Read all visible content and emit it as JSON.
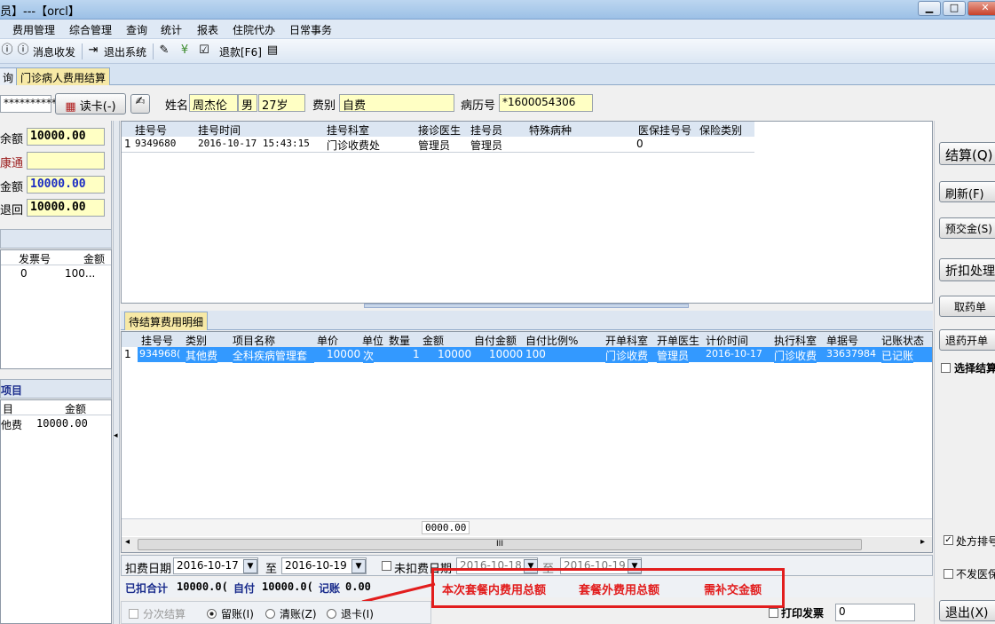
{
  "window": {
    "title": "员】---【orcl】",
    "min": "▁",
    "max": "□",
    "close": "✕"
  },
  "menu": [
    "费用管理",
    "综合管理",
    "查询",
    "统计",
    "报表",
    "住院代办",
    "日常事务"
  ],
  "toolbar": {
    "messages": "消息收发",
    "exit": "退出系统",
    "refund": "退款[F6]"
  },
  "tabs": {
    "prev": "询",
    "current": "门诊病人费用结算"
  },
  "patient": {
    "card_no": "**********",
    "read_card": "读卡(-)",
    "name_label": "姓名",
    "name": "周杰伦",
    "sex": "男",
    "age": "27岁",
    "fee_label": "费别",
    "fee_type": "自费",
    "record_label": "病历号",
    "record_no": "*1600054306"
  },
  "left_panel": {
    "balance_label": "余额",
    "balance": "10000.00",
    "jkt_label": "康通",
    "jkt": "",
    "amount_label": "金额",
    "amount": "10000.00",
    "return_label": "退回",
    "return_value": "10000.00",
    "invoice_headers": [
      "发票号",
      "金额"
    ],
    "invoice_rows": [
      [
        "0",
        "100..."
      ]
    ],
    "items_title": "项目",
    "items_headers": [
      "目",
      "金额"
    ],
    "items_rows": [
      [
        "他费",
        "10000.00"
      ]
    ]
  },
  "reg_table": {
    "headers": [
      "挂号号",
      "挂号时间",
      "挂号科室",
      "接诊医生",
      "挂号员",
      "特殊病种",
      "医保挂号号",
      "保险类别"
    ],
    "rows": [
      [
        "1",
        "9349680",
        "2016-10-17 15:43:15",
        "门诊收费处",
        "管理员",
        "管理员",
        "",
        "0",
        ""
      ]
    ]
  },
  "detail": {
    "tab": "待结算费用明细",
    "headers": [
      "挂号号",
      "类别",
      "项目名称",
      "单价",
      "单位",
      "数量",
      "金额",
      "自付金额",
      "自付比例%",
      "开单科室",
      "开单医生",
      "计价时间",
      "执行科室",
      "单据号",
      "记账状态"
    ],
    "rows": [
      [
        "1",
        "934968(",
        "其他费",
        "全科疾病管理套",
        "10000",
        "次",
        "1",
        "10000",
        "10000",
        "100",
        "门诊收费",
        "管理员",
        "2016-10-17",
        "门诊收费",
        "33637984",
        "已记账"
      ]
    ],
    "footer_total": "0000.00",
    "scroll_grip": "III"
  },
  "filters": {
    "deduct_label": "扣费日期",
    "deduct_from": "2016-10-17",
    "to_label": "至",
    "deduct_to": "2016-10-19",
    "undeduct_label": "未扣费日期",
    "undeduct_from": "2016-10-18",
    "undeduct_to": "2016-10-19"
  },
  "summary": {
    "deducted_label": "已扣合计",
    "deducted": "10000.0(",
    "self_pay_label": "自付",
    "self_pay": "10000.0(",
    "credit_label": "记账",
    "credit": "0.00"
  },
  "annotation": {
    "in_package": "本次套餐内费用总额",
    "out_package": "套餐外费用总额",
    "top_up": "需补交金额"
  },
  "options": {
    "split": "分次结算",
    "keep": "留账(I)",
    "clear": "清账(Z)",
    "refund_card": "退卡(I)",
    "print_invoice": "打印发票",
    "invoice_no": "0"
  },
  "right": {
    "settle": "结算(Q)",
    "refresh": "刷新(F)",
    "prepay": "预交金(S)",
    "discount": "折扣处理",
    "pick": "取药单",
    "refund_open": "退药开单",
    "select_settle": "选择结算",
    "rx_sort": "处方排号",
    "no_insurance": "不发医保",
    "exit": "退出(X)"
  },
  "colors": {
    "highlight": "#3399ff",
    "annotation": "#e21d1d",
    "yellow_field": "#ffffc4"
  }
}
